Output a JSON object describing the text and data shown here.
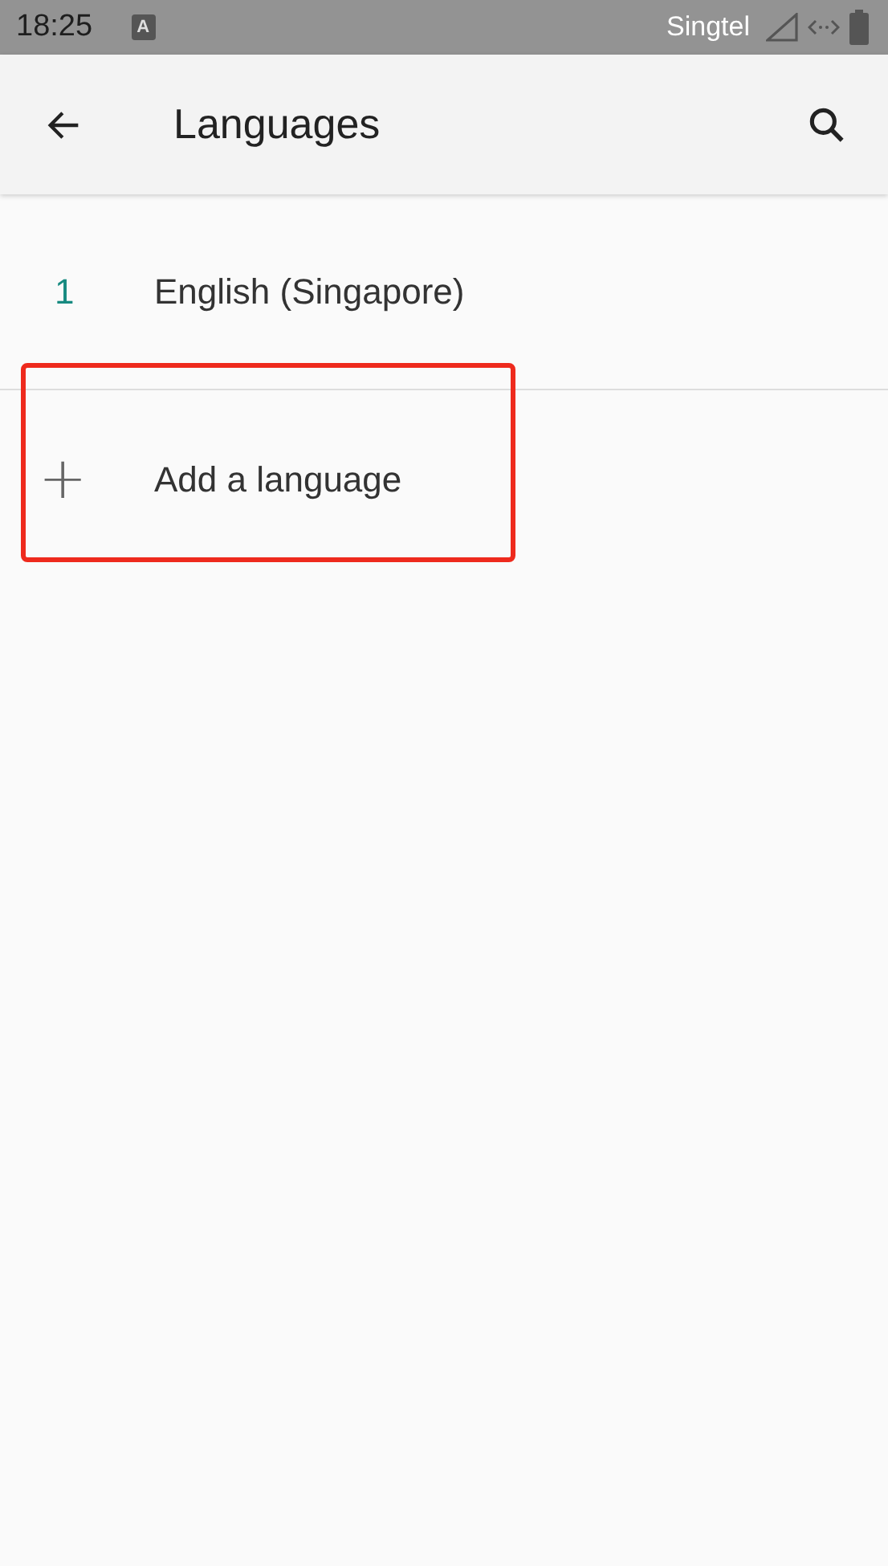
{
  "status_bar": {
    "time": "18:25",
    "notification_badge": "A",
    "carrier": "Singtel"
  },
  "app_bar": {
    "title": "Languages"
  },
  "languages": [
    {
      "number": "1",
      "name": "English (Singapore)"
    }
  ],
  "add_item": {
    "icon": "+",
    "label": "Add a language",
    "highlighted": true
  }
}
